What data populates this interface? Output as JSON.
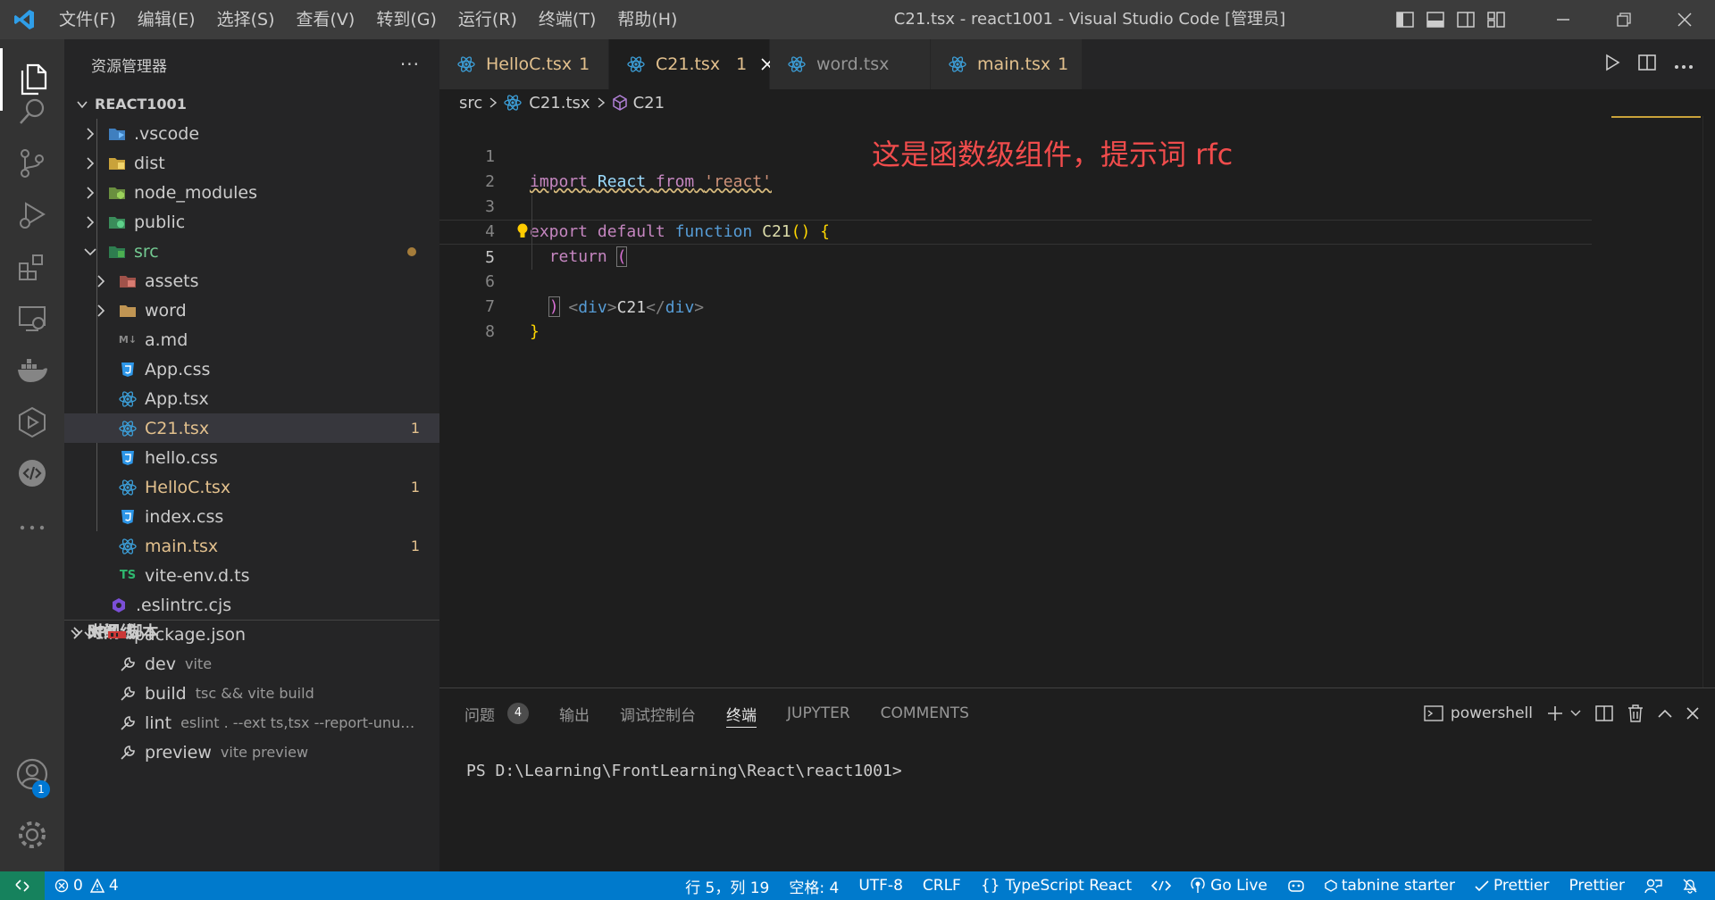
{
  "window": {
    "title": "C21.tsx - react1001 - Visual Studio Code [管理员]"
  },
  "menu": [
    "文件(F)",
    "编辑(E)",
    "选择(S)",
    "查看(V)",
    "转到(G)",
    "运行(R)",
    "终端(T)",
    "帮助(H)"
  ],
  "activity_bar": {
    "items": [
      "explorer-icon",
      "search-icon",
      "source-control-icon",
      "run-debug-icon",
      "extensions-icon",
      "remote-explorer-icon",
      "docker-icon",
      "live-share-icon",
      "codestream-icon",
      "more-icon"
    ],
    "account_badge": "1"
  },
  "sidebar": {
    "title": "资源管理器",
    "more": "···",
    "root": "REACT1001",
    "tree": [
      {
        "name": ".vscode"
      },
      {
        "name": "dist"
      },
      {
        "name": "node_modules"
      },
      {
        "name": "public"
      },
      {
        "name": "src"
      },
      {
        "name": "assets"
      },
      {
        "name": "word"
      },
      {
        "name": "a.md",
        "icon": "M↓"
      },
      {
        "name": "App.css"
      },
      {
        "name": "App.tsx"
      },
      {
        "name": "C21.tsx",
        "count": "1"
      },
      {
        "name": "hello.css"
      },
      {
        "name": "HelloC.tsx",
        "count": "1"
      },
      {
        "name": "index.css"
      },
      {
        "name": "main.tsx",
        "count": "1"
      },
      {
        "name": "vite-env.d.ts",
        "icon": "TS"
      },
      {
        "name": ".eslintrc.cjs"
      }
    ],
    "sections": {
      "outline": "大纲",
      "timeline": "时间线",
      "npm": "NPM 脚本"
    },
    "npm": {
      "file": "package.json",
      "scripts": [
        {
          "name": "dev",
          "cmd": "vite"
        },
        {
          "name": "build",
          "cmd": "tsc && vite build"
        },
        {
          "name": "lint",
          "cmd": "eslint . --ext ts,tsx --report-unuse..."
        },
        {
          "name": "preview",
          "cmd": "vite preview"
        }
      ]
    }
  },
  "tabs": [
    {
      "label": "HelloC.tsx",
      "count": "1"
    },
    {
      "label": "C21.tsx",
      "count": "1"
    },
    {
      "label": "word.tsx",
      "count": ""
    },
    {
      "label": "main.tsx",
      "count": "1"
    }
  ],
  "breadcrumb": [
    "src",
    "C21.tsx",
    "C21"
  ],
  "editor": {
    "line_numbers": [
      "1",
      "2",
      "3",
      "4",
      "5",
      "6",
      "7",
      "8"
    ],
    "tokens": {
      "import": "import",
      "react_id": "React",
      "from": "from",
      "react_str": "'react'",
      "export": "export",
      "default": "default",
      "function": "function",
      "fname": "C21",
      "parens": "()",
      "brace_open": "{",
      "return": "return",
      "paren_open": "(",
      "div_open_lt": "<",
      "div": "div",
      "gt": ">",
      "div_text": "C21",
      "close_lt": "</",
      "div2": "div",
      "gt2": ">",
      "paren_close": ")",
      "brace_close": "}"
    },
    "annotation": "这是函数级组件，提示词 rfc"
  },
  "panel": {
    "tabs": [
      "问题",
      "输出",
      "调试控制台",
      "终端",
      "JUPYTER",
      "COMMENTS"
    ],
    "problems_count": "4",
    "shell": "powershell",
    "prompt": "PS D:\\Learning\\FrontLearning\\React\\react1001>"
  },
  "statusbar": {
    "errors": "0",
    "warnings": "4",
    "position": "行 5，列 19",
    "spaces": "空格: 4",
    "encoding": "UTF-8",
    "eol": "CRLF",
    "language": "TypeScript React",
    "golive": "Go Live",
    "tabnine": "tabnine starter",
    "prettier_check": "Prettier",
    "prettier": "Prettier"
  },
  "colors": {
    "accent": "#007acc",
    "warning": "#e2c08d",
    "annotation": "#f14c4c"
  }
}
